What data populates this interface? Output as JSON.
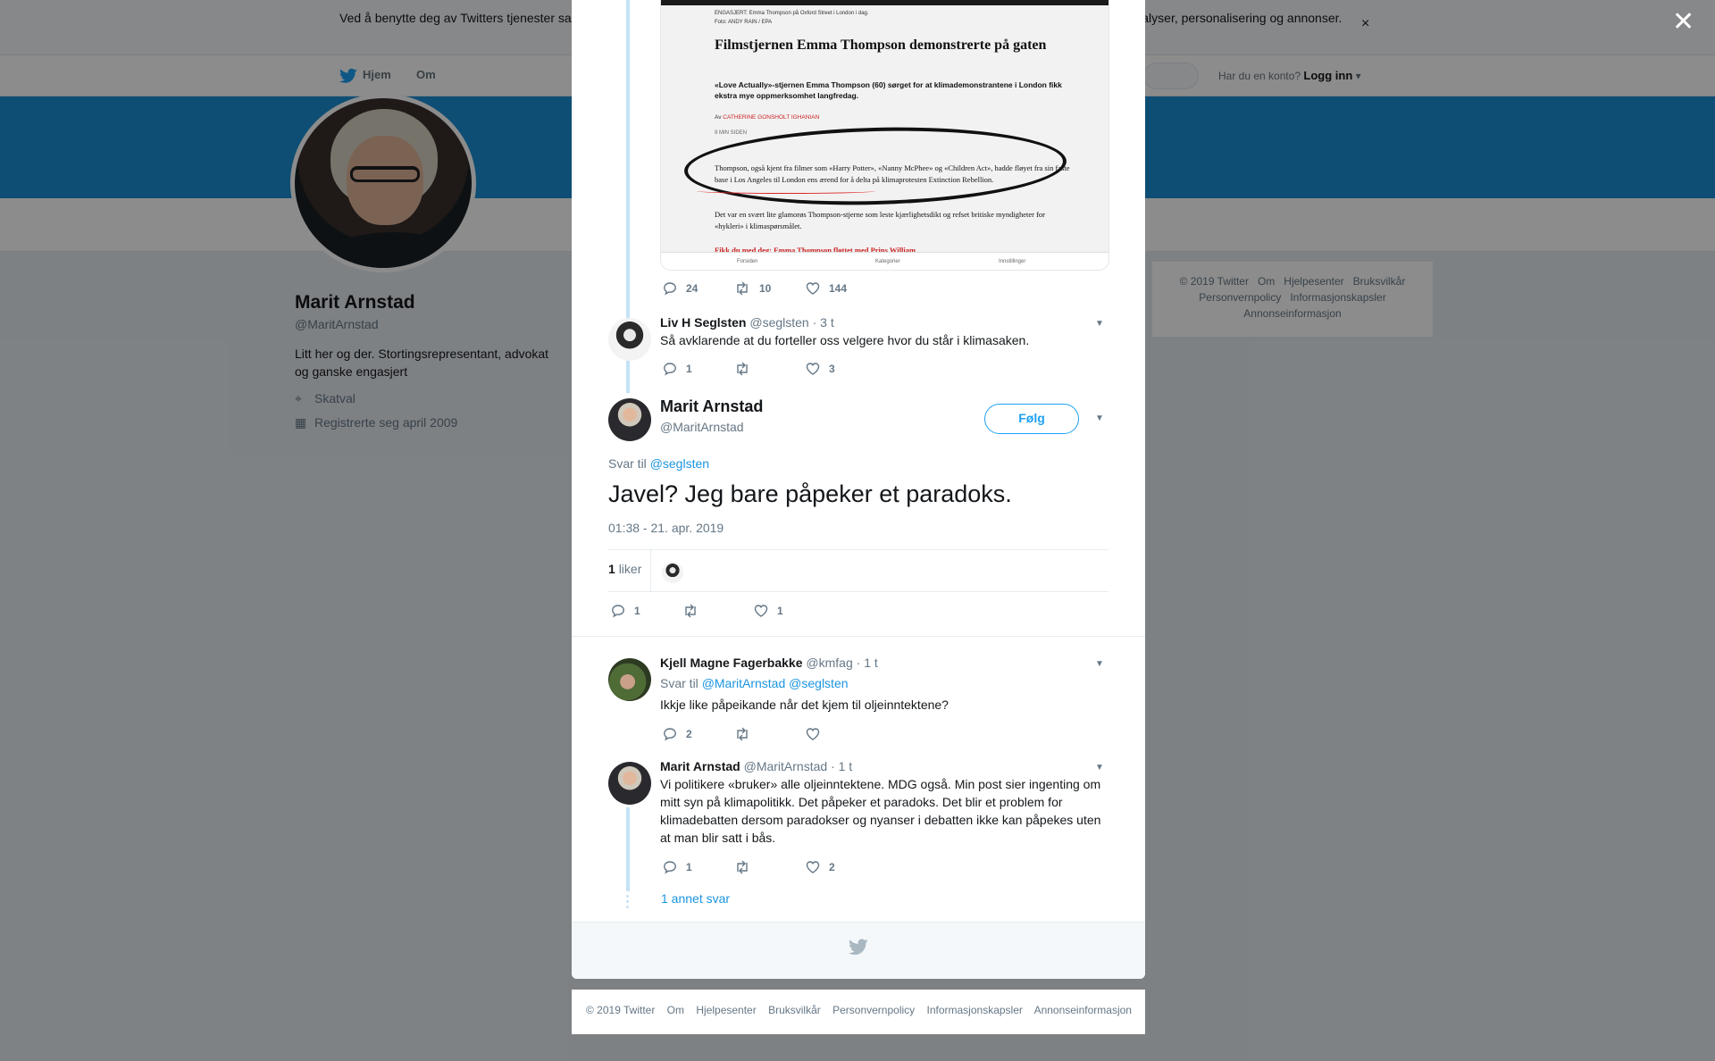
{
  "cookie_bar": {
    "text": "Ved å benytte deg av Twitters tjenester samtykker du i vår bruk av informasjonskapsler. Vi og våre partnere bruker informasjonskapsler til bl.a. analyser, personalisering og annonser."
  },
  "nav": {
    "home_label": "Hjem",
    "about_label": "Om",
    "login_prompt": "Har du en konto?",
    "login_label": "Logg inn"
  },
  "profile": {
    "name": "Marit Arnstad",
    "handle": "@MaritArnstad",
    "bio": "Litt her og der. Stortingsrepresentant, advokat og ganske engasjert",
    "location": "Skatval",
    "joined": "Registrerte seg april 2009"
  },
  "side_footer": {
    "links": [
      "© 2019 Twitter",
      "Om",
      "Hjelpesenter",
      "Bruksvilkår",
      "Personvernpolicy",
      "Informasjonskapsler",
      "Annonseinformasjon"
    ]
  },
  "media": {
    "caption_top": "ENGASJERT: Emma Thompson på Oxford Street i London i dag.",
    "caption_photo": "Foto: ANDY RAIN / EPA",
    "headline": "Filmstjernen Emma Thompson demonstrerte på gaten",
    "lead": "«Love Actually»-stjernen Emma Thompson (60) sørget for at klimademonstrantene i London fikk ekstra mye oppmerksomhet langfredag.",
    "byline_prefix": "Av",
    "byline_name": "CATHERINE GONSHOLT IGHANIAN",
    "read_time": "9 MIN SIDEN",
    "para1": "Thompson, også kjent fra filmer som «Harry Potter», «Nanny McPhee» og «Children Act», hadde fløyet fra sin faste base i Los Angeles til London ens ærend for å delta på klimaprotesten Extinction Rebellion.",
    "para2": "Det var en svært lite glamorøs Thompson-stjerne som leste kjærlighetsdikt og refset britiske myndigheter for «hykleri» i klimaspørsmålet.",
    "para3": "Fikk du med deg: Emma Thompson fløttet med Prins William",
    "tab1": "Forsiden",
    "tab2": "Kategorier",
    "tab3": "Innstillinger"
  },
  "tweet_media_actions": {
    "replies": "24",
    "retweets": "10",
    "likes": "144"
  },
  "tweet_liv": {
    "name": "Liv H Seglsten",
    "handle": "@seglsten",
    "time": "· 3 t",
    "text": "Så avklarende at du forteller oss velgere hvor du står i klimasaken.",
    "replies": "1",
    "retweets": "",
    "likes": "3"
  },
  "main_tweet": {
    "name": "Marit Arnstad",
    "handle": "@MaritArnstad",
    "follow_label": "Følg",
    "reply_prefix": "Svar til",
    "reply_to": "@seglsten",
    "text": "Javel? Jeg bare påpeker et paradoks.",
    "timestamp": "01:38 - 21. apr. 2019",
    "like_count": "1",
    "like_word": "liker",
    "replies": "1",
    "retweets": "",
    "likes": "1"
  },
  "tweet_kjell": {
    "name": "Kjell Magne Fagerbakke",
    "handle": "@kmfag",
    "time": "· 1 t",
    "reply_prefix": "Svar til",
    "reply_to_1": "@MaritArnstad",
    "reply_to_2": "@seglsten",
    "text": "Ikkje like påpeikande når det kjem til oljeinntektene?",
    "replies": "2",
    "retweets": "",
    "likes": ""
  },
  "tweet_marit_reply": {
    "name": "Marit Arnstad",
    "handle": "@MaritArnstad",
    "time": "· 1 t",
    "text": "Vi politikere «bruker» alle oljeinntektene. MDG også.  Min post sier ingenting om mitt syn på klimapolitikk. Det påpeker et paradoks. Det blir et problem for klimadebatten dersom paradokser og nyanser i debatten ikke kan påpekes uten at man blir satt i bås.",
    "replies": "1",
    "retweets": "",
    "likes": "2"
  },
  "more_replies_label": "1 annet svar",
  "bottom_footer": {
    "links": [
      "© 2019 Twitter",
      "Om",
      "Hjelpesenter",
      "Bruksvilkår",
      "Personvernpolicy",
      "Informasjonskapsler",
      "Annonseinformasjon"
    ]
  },
  "colors": {
    "accent": "#1da1f2",
    "banner": "#1d8fd3",
    "thread_line": "#c4e2f6"
  }
}
